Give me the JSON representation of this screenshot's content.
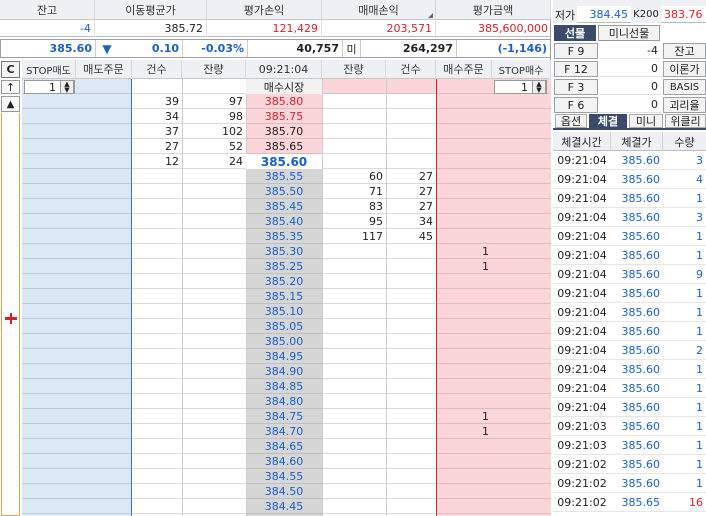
{
  "summary": {
    "headers": [
      "잔고",
      "이동평균가",
      "평가손익",
      "매매손익",
      "평가금액"
    ],
    "values": [
      "-4",
      "385.72",
      "121,429",
      "203,571",
      "385,600,000"
    ]
  },
  "quote_bar": {
    "price": "385.60",
    "arrow": "▼",
    "change": "0.10",
    "change_pct": "-0.03%",
    "volume": "40,757",
    "mi_label": "미",
    "open_interest": "264,297",
    "oi_change": "(-1,146)"
  },
  "order_header": {
    "c_label": "C",
    "stop_sell": "STOP매도",
    "sell_order": "매도주문",
    "count": "건수",
    "qty": "잔량",
    "time": "09:21:04",
    "qty2": "잔량",
    "count2": "건수",
    "buy_order": "매수주문",
    "stop_buy": "STOP매수",
    "stop_sell_qty": "1",
    "stop_buy_qty": "1",
    "market_buy": "매수시장",
    "up_arrow": "↑",
    "up_tri": "▲"
  },
  "ask_rows": [
    {
      "count": "39",
      "qty": "97",
      "price": "385.80"
    },
    {
      "count": "34",
      "qty": "98",
      "price": "385.75"
    },
    {
      "count": "37",
      "qty": "102",
      "price": "385.70"
    },
    {
      "count": "27",
      "qty": "52",
      "price": "385.65"
    },
    {
      "count": "12",
      "qty": "24",
      "price": "385.60"
    }
  ],
  "bid_rows": [
    {
      "price": "385.55",
      "qty": "60",
      "count": "27",
      "buy": ""
    },
    {
      "price": "385.50",
      "qty": "71",
      "count": "27",
      "buy": ""
    },
    {
      "price": "385.45",
      "qty": "83",
      "count": "27",
      "buy": ""
    },
    {
      "price": "385.40",
      "qty": "95",
      "count": "34",
      "buy": ""
    },
    {
      "price": "385.35",
      "qty": "117",
      "count": "45",
      "buy": ""
    },
    {
      "price": "385.30",
      "qty": "",
      "count": "",
      "buy": "1"
    },
    {
      "price": "385.25",
      "qty": "",
      "count": "",
      "buy": "1"
    },
    {
      "price": "385.20",
      "qty": "",
      "count": "",
      "buy": ""
    },
    {
      "price": "385.15",
      "qty": "",
      "count": "",
      "buy": ""
    },
    {
      "price": "385.10",
      "qty": "",
      "count": "",
      "buy": ""
    },
    {
      "price": "385.05",
      "qty": "",
      "count": "",
      "buy": ""
    },
    {
      "price": "385.00",
      "qty": "",
      "count": "",
      "buy": ""
    },
    {
      "price": "384.95",
      "qty": "",
      "count": "",
      "buy": ""
    },
    {
      "price": "384.90",
      "qty": "",
      "count": "",
      "buy": ""
    },
    {
      "price": "384.85",
      "qty": "",
      "count": "",
      "buy": ""
    },
    {
      "price": "384.80",
      "qty": "",
      "count": "",
      "buy": ""
    },
    {
      "price": "384.75",
      "qty": "",
      "count": "",
      "buy": "1"
    },
    {
      "price": "384.70",
      "qty": "",
      "count": "",
      "buy": "1"
    },
    {
      "price": "384.65",
      "qty": "",
      "count": "",
      "buy": ""
    },
    {
      "price": "384.60",
      "qty": "",
      "count": "",
      "buy": ""
    },
    {
      "price": "384.55",
      "qty": "",
      "count": "",
      "buy": ""
    },
    {
      "price": "384.50",
      "qty": "",
      "count": "",
      "buy": ""
    },
    {
      "price": "384.45",
      "qty": "",
      "count": "",
      "buy": ""
    }
  ],
  "right": {
    "low_label": "저가",
    "low_value": "384.45",
    "k200_label": "K200",
    "k200_value": "383.76",
    "tabs": [
      "선물",
      "미니선물"
    ],
    "keys": [
      {
        "key": "F 9",
        "value": "-4",
        "side": "잔고"
      },
      {
        "key": "F 12",
        "value": "0",
        "side": "이론가"
      },
      {
        "key": "F 3",
        "value": "0",
        "side": "BASIS"
      },
      {
        "key": "F 6",
        "value": "0",
        "side": "괴리율"
      }
    ],
    "subtabs": [
      "옵션",
      "체결",
      "미니",
      "위클리"
    ],
    "trade_headers": [
      "체결시간",
      "체결가",
      "수량"
    ],
    "trades": [
      {
        "time": "09:21:04",
        "price": "385.60",
        "qty": "3"
      },
      {
        "time": "09:21:04",
        "price": "385.60",
        "qty": "4"
      },
      {
        "time": "09:21:04",
        "price": "385.60",
        "qty": "1"
      },
      {
        "time": "09:21:04",
        "price": "385.60",
        "qty": "3"
      },
      {
        "time": "09:21:04",
        "price": "385.60",
        "qty": "1"
      },
      {
        "time": "09:21:04",
        "price": "385.60",
        "qty": "1"
      },
      {
        "time": "09:21:04",
        "price": "385.60",
        "qty": "9"
      },
      {
        "time": "09:21:04",
        "price": "385.60",
        "qty": "1"
      },
      {
        "time": "09:21:04",
        "price": "385.60",
        "qty": "1"
      },
      {
        "time": "09:21:04",
        "price": "385.60",
        "qty": "1"
      },
      {
        "time": "09:21:04",
        "price": "385.60",
        "qty": "2"
      },
      {
        "time": "09:21:04",
        "price": "385.60",
        "qty": "1"
      },
      {
        "time": "09:21:04",
        "price": "385.60",
        "qty": "1"
      },
      {
        "time": "09:21:04",
        "price": "385.60",
        "qty": "1"
      },
      {
        "time": "09:21:03",
        "price": "385.60",
        "qty": "1"
      },
      {
        "time": "09:21:03",
        "price": "385.60",
        "qty": "1"
      },
      {
        "time": "09:21:02",
        "price": "385.60",
        "qty": "1"
      },
      {
        "time": "09:21:02",
        "price": "385.60",
        "qty": "1"
      },
      {
        "time": "09:21:02",
        "price": "385.65",
        "qty": "16"
      }
    ]
  },
  "colors": {
    "ask_bg": "#dbe9f7",
    "bid_bg": "#fbd5d8",
    "price_col": "#d6d6d6",
    "blue": "#1a5fc9",
    "red": "#d8222a",
    "tab_active": "#3b4b6b"
  }
}
